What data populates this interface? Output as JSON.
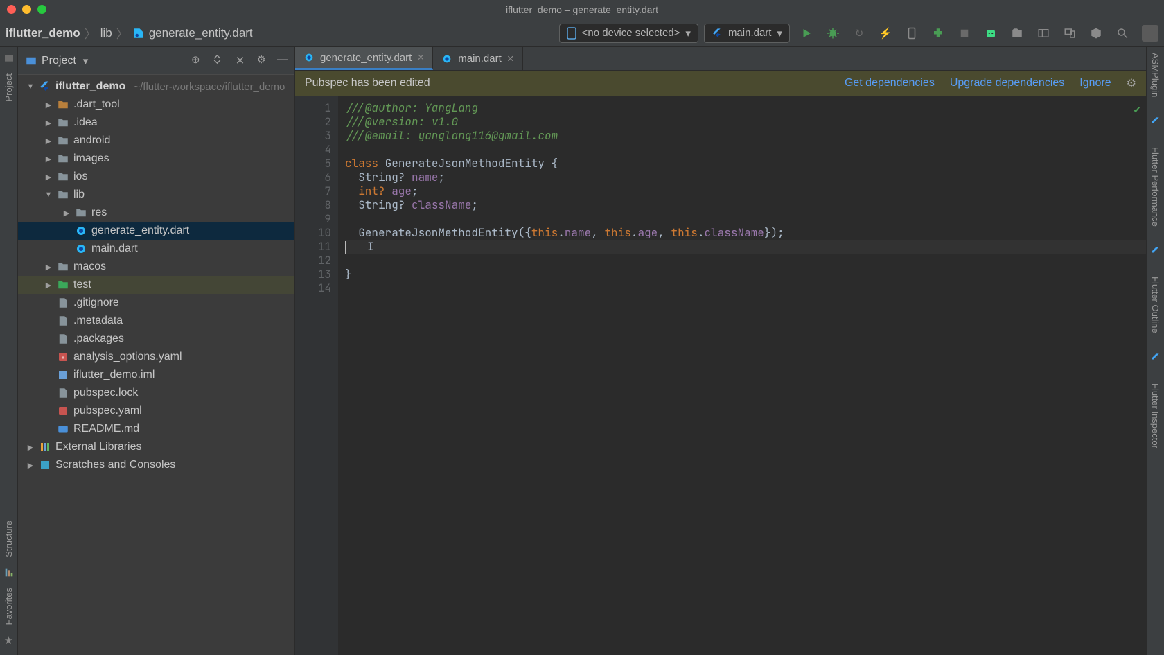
{
  "window": {
    "title": "iflutter_demo – generate_entity.dart"
  },
  "breadcrumb": {
    "project": "iflutter_demo",
    "folder": "lib",
    "file": "generate_entity.dart"
  },
  "toolbar": {
    "device": "<no device selected>",
    "run_config": "main.dart"
  },
  "sidebar": {
    "panel_title": "Project",
    "root": "iflutter_demo",
    "root_path": "~/flutter-workspace/iflutter_demo",
    "items": {
      "dart_tool": ".dart_tool",
      "idea": ".idea",
      "android": "android",
      "images": "images",
      "ios": "ios",
      "lib": "lib",
      "res": "res",
      "gen_entity": "generate_entity.dart",
      "main_dart": "main.dart",
      "macos": "macos",
      "test": "test",
      "gitignore": ".gitignore",
      "metadata": ".metadata",
      "packages": ".packages",
      "analysis": "analysis_options.yaml",
      "iml": "iflutter_demo.iml",
      "pubspec_lock": "pubspec.lock",
      "pubspec_yaml": "pubspec.yaml",
      "readme": "README.md",
      "ext_lib": "External Libraries",
      "scratches": "Scratches and Consoles"
    }
  },
  "tabs": {
    "active": "generate_entity.dart",
    "other": "main.dart"
  },
  "banner": {
    "message": "Pubspec has been edited",
    "action1": "Get dependencies",
    "action2": "Upgrade dependencies",
    "action3": "Ignore"
  },
  "left_rail": {
    "project": "Project",
    "structure": "Structure",
    "favorites": "Favorites"
  },
  "right_rail": {
    "asm": "ASMPlugin",
    "perf": "Flutter Performance",
    "outline": "Flutter Outline",
    "inspector": "Flutter Inspector"
  },
  "code": {
    "line1_a": "///@author: ",
    "line1_b": "YangLang",
    "line2_a": "///@version: ",
    "line2_b": "v1.0",
    "line3_a": "///@email: ",
    "line3_b": "yanglang116@gmail.com",
    "kw_class": "class",
    "cls_name": "GenerateJsonMethodEntity",
    "brace_open": " {",
    "f1_type": "  String? ",
    "f1_name": "name",
    "f2_type": "  int? ",
    "f2_name": "age",
    "f3_type": "  String? ",
    "f3_name": "className",
    "semi": ";",
    "ctor_name": "GenerateJsonMethodEntity",
    "ctor_open": "({",
    "kw_this": "this",
    "dot": ".",
    "comma": ", ",
    "ctor_close": "});",
    "brace_close": "}",
    "lines": [
      "1",
      "2",
      "3",
      "4",
      "5",
      "6",
      "7",
      "8",
      "9",
      "10",
      "11",
      "12",
      "13",
      "14"
    ]
  }
}
